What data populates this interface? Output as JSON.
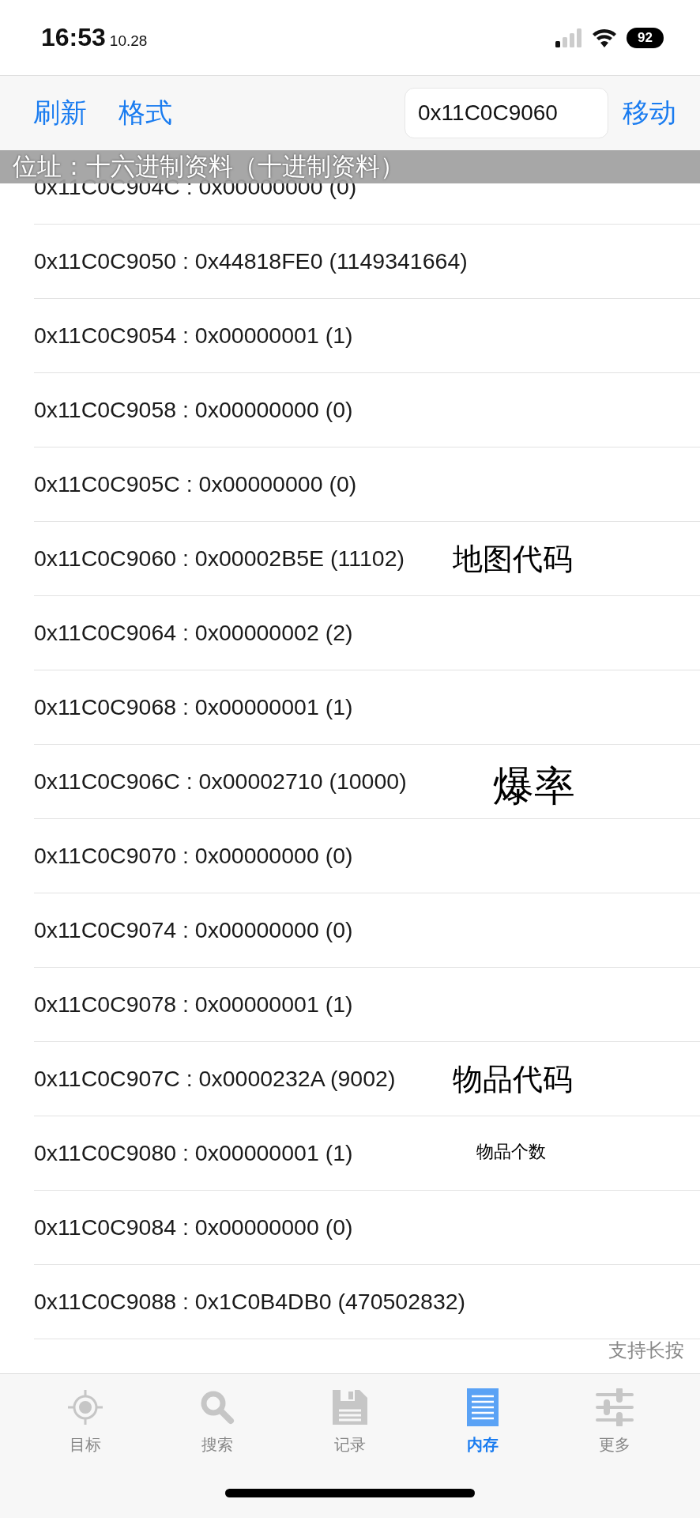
{
  "status_bar": {
    "time": "16:53",
    "date": "10.28",
    "battery": "92"
  },
  "toolbar": {
    "buttons": [
      "刷新",
      "格式"
    ],
    "address_field": {
      "value": "0x11C0C9060"
    },
    "go_button": "移动"
  },
  "header": "位址：十六进制资料（十进制资料）",
  "rows": [
    {
      "text": "0x11C0C904C : 0x00000000 (0)"
    },
    {
      "text": "0x11C0C9050 : 0x44818FE0 (1149341664)"
    },
    {
      "text": "0x11C0C9054 : 0x00000001 (1)"
    },
    {
      "text": "0x11C0C9058 : 0x00000000 (0)"
    },
    {
      "text": "0x11C0C905C : 0x00000000 (0)"
    },
    {
      "text": "0x11C0C9060 : 0x00002B5E (11102)",
      "note": {
        "text": "地图代码",
        "kind": "medium"
      }
    },
    {
      "text": "0x11C0C9064 : 0x00000002 (2)"
    },
    {
      "text": "0x11C0C9068 : 0x00000001 (1)"
    },
    {
      "text": "0x11C0C906C : 0x00002710 (10000)",
      "note": {
        "text": "爆率",
        "kind": "large"
      }
    },
    {
      "text": "0x11C0C9070 : 0x00000000 (0)"
    },
    {
      "text": "0x11C0C9074 : 0x00000000 (0)"
    },
    {
      "text": "0x11C0C9078 : 0x00000001 (1)"
    },
    {
      "text": "0x11C0C907C : 0x0000232A (9002)",
      "note": {
        "text": "物品代码",
        "kind": "medium"
      }
    },
    {
      "text": "0x11C0C9080 : 0x00000001 (1)",
      "note": {
        "text": "物品个数",
        "kind": "small"
      }
    },
    {
      "text": "0x11C0C9084 : 0x00000000 (0)"
    },
    {
      "text": "0x11C0C9088 : 0x1C0B4DB0 (470502832)"
    }
  ],
  "hint": "支持长按",
  "tabs": [
    {
      "label": "目标",
      "kind": "target",
      "selected": false
    },
    {
      "label": "搜索",
      "kind": "search",
      "selected": false
    },
    {
      "label": "记录",
      "kind": "save",
      "selected": false
    },
    {
      "label": "内存",
      "kind": "memory",
      "selected": true
    },
    {
      "label": "更多",
      "kind": "more",
      "selected": false
    }
  ]
}
